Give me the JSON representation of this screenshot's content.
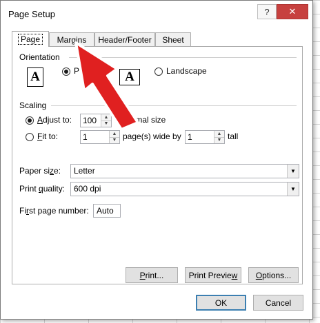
{
  "dialog": {
    "title": "Page Setup",
    "help_button": "?",
    "close_button": "✕"
  },
  "tabs": [
    {
      "label": "Page",
      "active": true
    },
    {
      "label": "Margins",
      "active": false
    },
    {
      "label": "Header/Footer",
      "active": false
    },
    {
      "label": "Sheet",
      "active": false
    }
  ],
  "orientation": {
    "label": "Orientation",
    "portrait_icon": "A",
    "portrait_label_partial": "P",
    "landscape_icon": "A",
    "landscape_label": "Landscape",
    "selected": "portrait"
  },
  "scaling": {
    "label": "Scaling",
    "adjust_to": {
      "prefix": "A",
      "rest": "djust to:",
      "value": "100",
      "suffix": "% normal size",
      "selected": true
    },
    "fit_to": {
      "prefix": "F",
      "rest": "it to:",
      "pages_wide": "1",
      "wide_by_label": "page(s) wide by",
      "pages_tall": "1",
      "tall_label": "tall",
      "selected": false
    }
  },
  "paper_size": {
    "prefix": "Paper si",
    "u": "z",
    "rest": "e:",
    "value": "Letter"
  },
  "print_quality": {
    "prefix": "Print ",
    "u": "q",
    "rest": "uality:",
    "value": "600 dpi"
  },
  "first_page_number": {
    "prefix": "Fi",
    "u": "r",
    "rest": "st page number:",
    "value": "Auto"
  },
  "buttons": {
    "print": {
      "u": "P",
      "rest": "rint..."
    },
    "print_preview": {
      "pre": "Print Previe",
      "u": "w",
      "rest": ""
    },
    "options": {
      "u": "O",
      "rest": "ptions..."
    },
    "ok": "OK",
    "cancel": "Cancel"
  },
  "annotation": {
    "arrow_color": "#e02020",
    "arrow_outline": "#ffffff"
  }
}
